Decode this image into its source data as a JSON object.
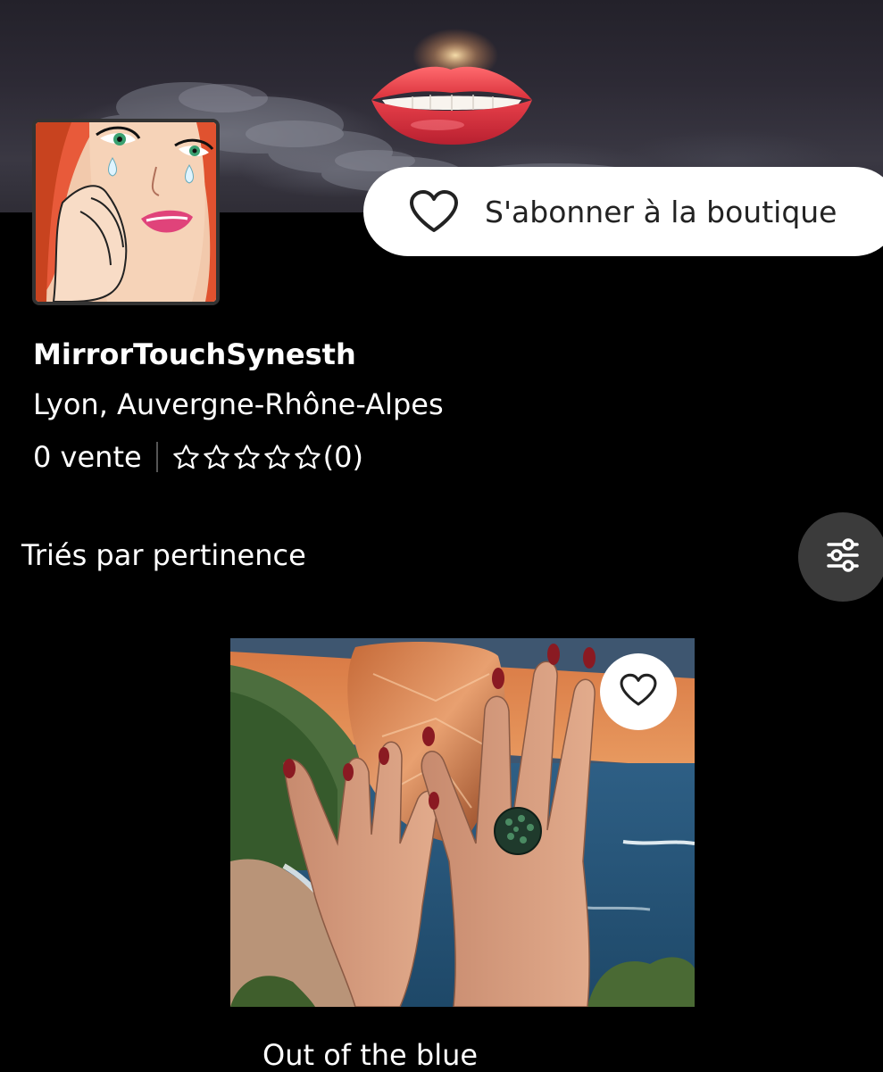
{
  "shop": {
    "follow_label": "S'abonner à la boutique",
    "name": "MirrorTouchSynesth",
    "location": "Lyon, Auvergne-Rhône-Alpes",
    "sales": "0 vente",
    "rating_stars": 0,
    "rating_max": 5,
    "review_count": "(0)"
  },
  "listing": {
    "sort_label": "Triés par pertinence",
    "items": [
      {
        "title": "Out of the blue"
      }
    ]
  },
  "icons": {
    "follow": "heart-outline-icon",
    "rating": "star-outline-icon",
    "filter": "sliders-icon",
    "favorite": "heart-outline-icon"
  },
  "colors": {
    "background": "#000000",
    "text": "#ffffff",
    "button_bg": "#ffffff",
    "button_text": "#222222",
    "filter_bg": "#3b3b3b",
    "lips": "#e8404a"
  }
}
